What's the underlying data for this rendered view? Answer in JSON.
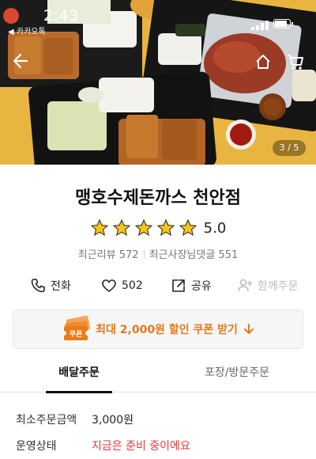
{
  "status_bar": {
    "time": "2:43",
    "back_app": "◀ 카카오톡",
    "battery_level": 0.75
  },
  "hero": {
    "page_indicator": "3 / 5",
    "current_page": 3,
    "total_pages": 5
  },
  "store": {
    "name": "맹호수제돈까스 천안점",
    "rating_value": "5.0",
    "stars": 5,
    "recent_reviews": "최근리뷰 572",
    "owner_replies": "최근사장님댓글 551"
  },
  "actions": {
    "call_label": "전화",
    "like_count": "502",
    "share_label": "공유",
    "group_order_label": "함께주문"
  },
  "coupon": {
    "label": "최대 2,000원 할인 쿠폰 받기",
    "icon_text": "쿠폰"
  },
  "tabs": [
    {
      "label": "배달주문",
      "active": true
    },
    {
      "label": "포장/방문주문",
      "active": false
    }
  ],
  "info": {
    "min_order_label": "최소주문금액",
    "min_order_value": "3,000원",
    "status_label": "운영상태",
    "status_value": "지금은 준비 중이에요"
  },
  "colors": {
    "accent_orange": "#e7781a",
    "star_yellow": "#f5c518",
    "alert_red": "#e53935"
  }
}
